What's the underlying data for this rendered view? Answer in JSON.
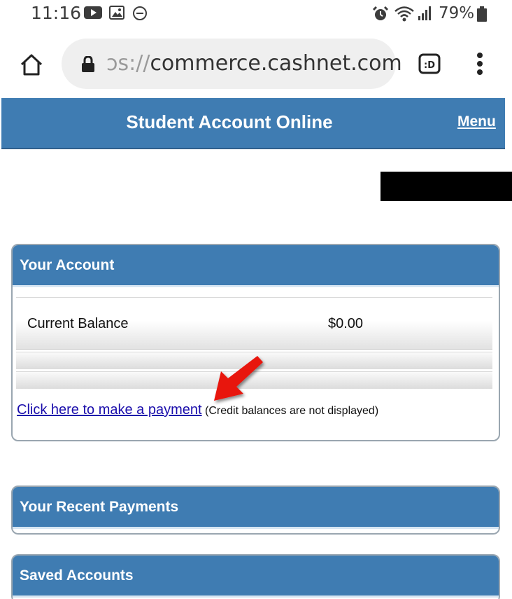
{
  "status_bar": {
    "time": "11:16",
    "battery": "79%",
    "icons": [
      "youtube-icon",
      "image-icon",
      "do-not-disturb-icon",
      "alarm-icon",
      "wifi-icon",
      "signal-icon",
      "battery-icon"
    ]
  },
  "browser": {
    "url_dim": "ɔs://",
    "url_main": "commerce.cashnet.com",
    "tabs_label": ":D"
  },
  "header": {
    "title": "Student Account Online",
    "menu": "Menu",
    "color": "#3f7cb2"
  },
  "account_panel": {
    "title": "Your Account",
    "balance_label": "Current Balance",
    "balance_value": "$0.00",
    "payment_link": "Click here to make a payment",
    "note": "(Credit balances are not displayed)"
  },
  "recent_payments": {
    "title": "Your Recent Payments"
  },
  "saved_accounts": {
    "title": "Saved Accounts"
  },
  "annotation": {
    "arrow_color": "#e8140c"
  }
}
